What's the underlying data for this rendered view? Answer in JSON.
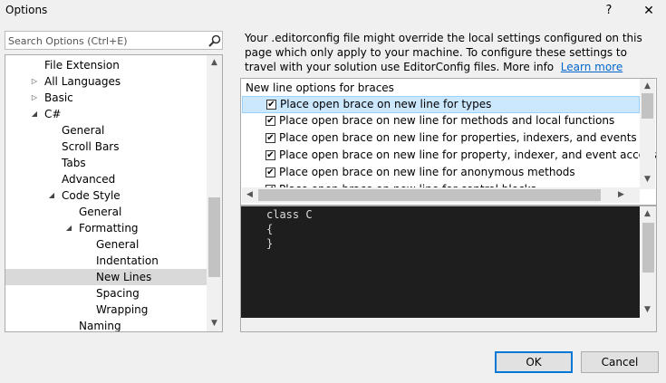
{
  "window": {
    "title": "Options",
    "help_label": "?",
    "close_label": "✕"
  },
  "search": {
    "placeholder": "Search Options (Ctrl+E)"
  },
  "tree": {
    "items": [
      {
        "label": "File Extension",
        "arrow": ""
      },
      {
        "label": "All Languages",
        "arrow": "▷"
      },
      {
        "label": "Basic",
        "arrow": "▷"
      },
      {
        "label": "C#",
        "arrow": "◢"
      },
      {
        "label": "General",
        "arrow": ""
      },
      {
        "label": "Scroll Bars",
        "arrow": ""
      },
      {
        "label": "Tabs",
        "arrow": ""
      },
      {
        "label": "Advanced",
        "arrow": ""
      },
      {
        "label": "Code Style",
        "arrow": "◢"
      },
      {
        "label": "General",
        "arrow": ""
      },
      {
        "label": "Formatting",
        "arrow": "◢"
      },
      {
        "label": "General",
        "arrow": ""
      },
      {
        "label": "Indentation",
        "arrow": ""
      },
      {
        "label": "New Lines",
        "arrow": ""
      },
      {
        "label": "Spacing",
        "arrow": ""
      },
      {
        "label": "Wrapping",
        "arrow": ""
      },
      {
        "label": "Naming",
        "arrow": ""
      }
    ]
  },
  "info": {
    "text": "Your .editorconfig file might override the local settings configured on this page which only apply to your machine. To configure these settings to travel with your solution use EditorConfig files. More info",
    "link_label": "Learn more"
  },
  "options": {
    "section_header": "New line options for braces",
    "items": [
      {
        "label": "Place open brace on new line for types",
        "checked": "✔"
      },
      {
        "label": "Place open brace on new line for methods and local functions",
        "checked": "✔"
      },
      {
        "label": "Place open brace on new line for properties, indexers, and events",
        "checked": "✔"
      },
      {
        "label": "Place open brace on new line for property, indexer, and event accessors",
        "checked": "✔"
      },
      {
        "label": "Place open brace on new line for anonymous methods",
        "checked": "✔"
      },
      {
        "label": "Place open brace on new line for control blocks",
        "checked": "✔"
      }
    ]
  },
  "code_preview": {
    "lines": [
      "class C",
      "{",
      "}"
    ]
  },
  "buttons": {
    "ok_label": "OK",
    "cancel_label": "Cancel"
  },
  "scroll": {
    "up": "▲",
    "down": "▼",
    "left": "◀",
    "right": "▶"
  },
  "icons": {
    "search": "search-icon"
  },
  "colors": {
    "accent": "#0078d7",
    "selection": "#cce8ff",
    "link": "#0066cc",
    "code_bg": "#1e1e1e"
  }
}
